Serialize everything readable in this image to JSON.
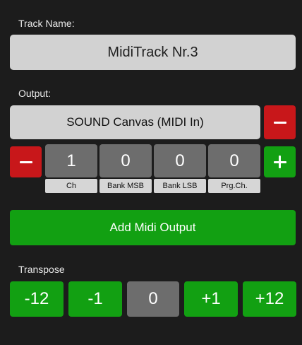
{
  "track": {
    "label": "Track Name:",
    "name": "MidiTrack Nr.3"
  },
  "output": {
    "label": "Output:",
    "device": "SOUND Canvas (MIDI In)",
    "remove_icon": "minus-icon",
    "decrement_icon": "minus-icon",
    "increment_icon": "plus-icon",
    "params": [
      {
        "value": "1",
        "label": "Ch"
      },
      {
        "value": "0",
        "label": "Bank MSB"
      },
      {
        "value": "0",
        "label": "Bank LSB"
      },
      {
        "value": "0",
        "label": "Prg.Ch."
      }
    ]
  },
  "add_output": {
    "label": "Add Midi Output"
  },
  "transpose": {
    "label": "Transpose",
    "buttons": [
      "-12",
      "-1",
      "0",
      "+1",
      "+12"
    ]
  },
  "colors": {
    "background": "#1c1c1c",
    "field": "#d2d2d2",
    "accent_green": "#12a012",
    "accent_red": "#c8171a",
    "value_box": "#6d6d6d"
  }
}
